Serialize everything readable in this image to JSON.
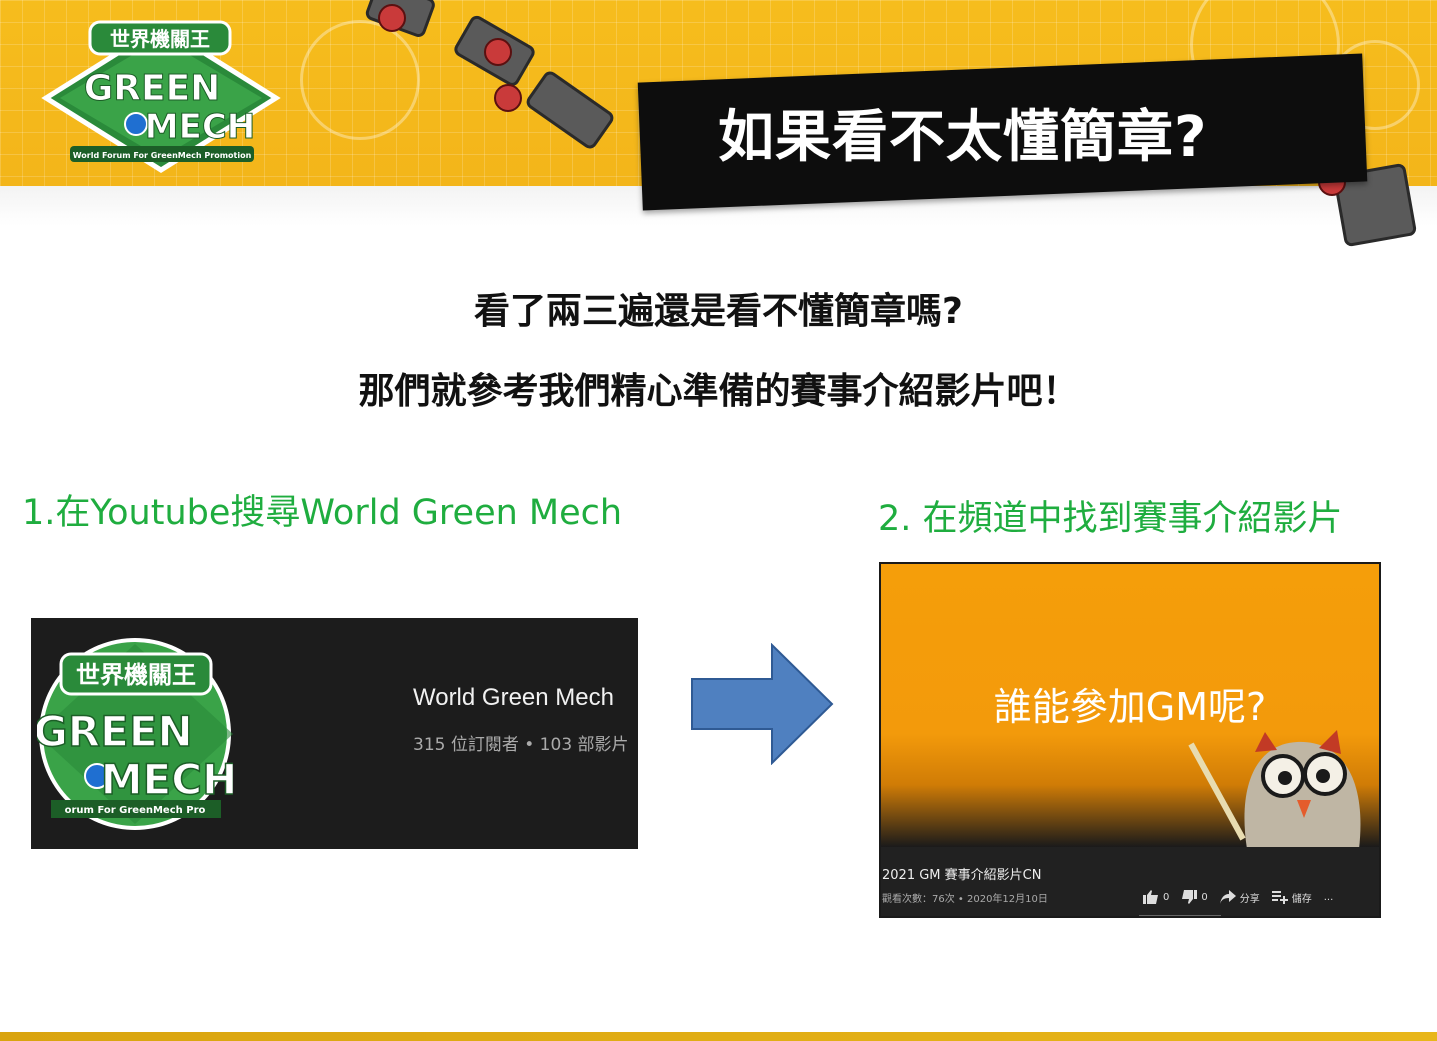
{
  "header": {
    "logo_top_text": "世界機關王",
    "logo_main_1": "GREEN",
    "logo_main_2": "MECH",
    "logo_sub": "World Forum For GreenMech Promotion",
    "title": "如果看不太懂簡章?"
  },
  "intro": {
    "line1": "看了兩三遍還是看不懂簡章嗎?",
    "line2": "那們就參考我們精心準備的賽事介紹影片吧！"
  },
  "steps": {
    "step1": "1.在Youtube搜尋World Green Mech",
    "step2": "2. 在頻道中找到賽事介紹影片"
  },
  "channel": {
    "avatar_top": "世界機關王",
    "avatar_main_1": "GREEN",
    "avatar_main_2": "MECH",
    "avatar_sub": "orum For GreenMech Pro",
    "name": "World Green Mech",
    "stats": "315 位訂閱者 • 103 部影片"
  },
  "video": {
    "overlay_title": "誰能參加GM呢?",
    "name": "2021 GM 賽事介紹影片CN",
    "meta": "觀看次數：76次 • 2020年12月10日",
    "likes": "0",
    "dislikes": "0",
    "share_label": "分享",
    "save_label": "儲存",
    "more_label": "..."
  },
  "colors": {
    "banner": "#f6bd1d",
    "step_green": "#1fad3f",
    "arrow_blue": "#4f80c0",
    "video_orange": "#f59e0a"
  }
}
